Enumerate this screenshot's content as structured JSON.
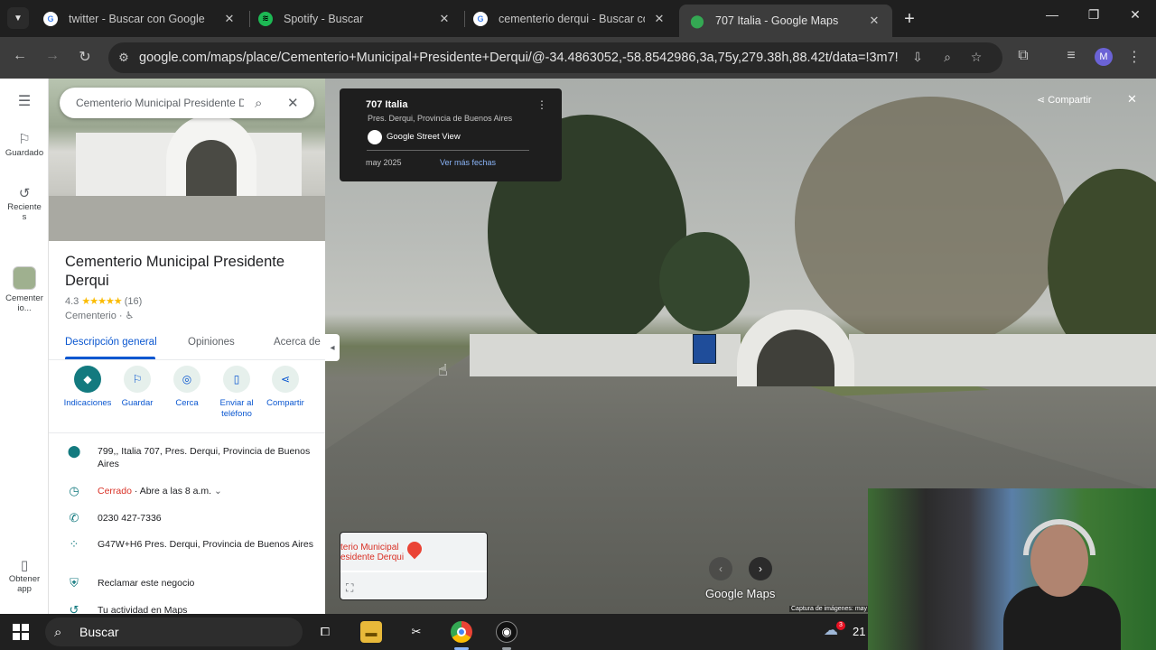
{
  "browser": {
    "tabs": [
      {
        "title": "twitter - Buscar con Google",
        "favicon": "google-icon"
      },
      {
        "title": "Spotify - Buscar",
        "favicon": "spotify-icon"
      },
      {
        "title": "cementerio derqui - Buscar con",
        "favicon": "google-icon"
      },
      {
        "title": "707 Italia - Google Maps",
        "favicon": "maps-pin-icon",
        "active": true
      }
    ],
    "new_tab": "+",
    "url": "google.com/maps/place/Cementerio+Municipal+Presidente+Derqui/@-34.4863052,-58.8542986,3a,75y,279.38h,88.42t/data=!3m7!1e...",
    "profile_initial": "M"
  },
  "rail": {
    "items": [
      {
        "label": "Guardado",
        "icon": "bookmark-icon"
      },
      {
        "label": "Reciente s",
        "icon": "history-icon"
      },
      {
        "label": "Cementer io...",
        "icon": "place-thumb-icon"
      },
      {
        "label": "Obtener app",
        "icon": "phone-icon"
      }
    ]
  },
  "panel": {
    "search_value": "Cementerio Municipal Presidente De",
    "place_name": "Cementerio Municipal Presidente Derqui",
    "rating": "4.3",
    "stars": "★★★★★",
    "review_count": "(16)",
    "category": "Cementerio · ♿",
    "tabs": [
      "Descripción general",
      "Opiniones",
      "Acerca de"
    ],
    "actions": [
      {
        "label": "Indicaciones",
        "icon": "directions-icon"
      },
      {
        "label": "Guardar",
        "icon": "bookmark-icon"
      },
      {
        "label": "Cerca",
        "icon": "nearby-icon"
      },
      {
        "label": "Enviar al teléfono",
        "icon": "send-to-phone-icon"
      },
      {
        "label": "Compartir",
        "icon": "share-icon"
      }
    ],
    "address": "799,, Italia 707, Pres. Derqui, Provincia de Buenos Aires",
    "hours_status": "Cerrado",
    "hours_detail": " · Abre a las 8 a.m.",
    "phone": "0230 427-7336",
    "plus_code": "G47W+H6 Pres. Derqui, Provincia de Buenos Aires",
    "claim": "Reclamar este negocio",
    "activity": "Tu actividad en Maps"
  },
  "streetview": {
    "address_title": "707 Italia",
    "address_sub": "Pres. Derqui, Provincia de Buenos Aires",
    "source": "Google Street View",
    "date": "may 2025",
    "more_dates": "Ver más fechas",
    "share_label": "Compartir",
    "minimap_label": "terio Municipal\nesidente Derqui",
    "logo": "Google Maps",
    "capture_text": "Captura de imágenes: may"
  },
  "taskbar": {
    "search_label": "Buscar",
    "weather_badge": "3",
    "temperature": "21"
  },
  "colors": {
    "accent": "#0b57d0",
    "teal": "#137a7f",
    "closed": "#d93025"
  }
}
